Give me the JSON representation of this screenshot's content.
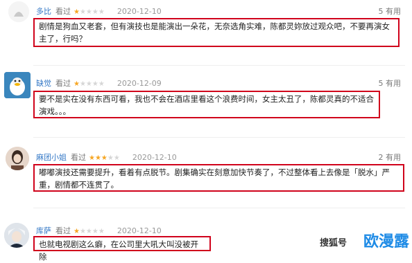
{
  "reviews": [
    {
      "user": "多比",
      "verb": "看过",
      "rating": 1,
      "date": "2020-12-10",
      "useful": "5 有用",
      "text": "剧情是狗血又老套，但有演技也是能演出一朵花，无奈选角实难，陈都灵妳放过观众吧，不要再演女主了，行吗？"
    },
    {
      "user": "缺觉",
      "verb": "看过",
      "rating": 1,
      "date": "2020-12-09",
      "useful": "5 有用",
      "text": "要不是实在没有东西可看，我也不会在酒店里看这个浪费时间，女主太丑了，陈都灵真的不适合演戏。。。"
    },
    {
      "user": "麻团小姐",
      "verb": "看过",
      "rating": 3,
      "date": "2020-12-10",
      "useful": "2 有用",
      "text": "嘟嘟演技还需要提升，看着有点脱节。剧集确实在刻意加快节奏了，不过整体看上去像是「脱水」严重，剧情都不连贯了。"
    },
    {
      "user": "库萨",
      "verb": "看过",
      "rating": 1,
      "date": "2020-12-10",
      "useful": "",
      "text": "也就电视剧这么癖，在公司里大吼大叫没被开除"
    }
  ],
  "watermark": {
    "brand": "欧漫露",
    "source": "搜狐号"
  },
  "colors": {
    "highlight_border": "#d0021b",
    "username": "#3478c6",
    "star": "#f6a623"
  }
}
